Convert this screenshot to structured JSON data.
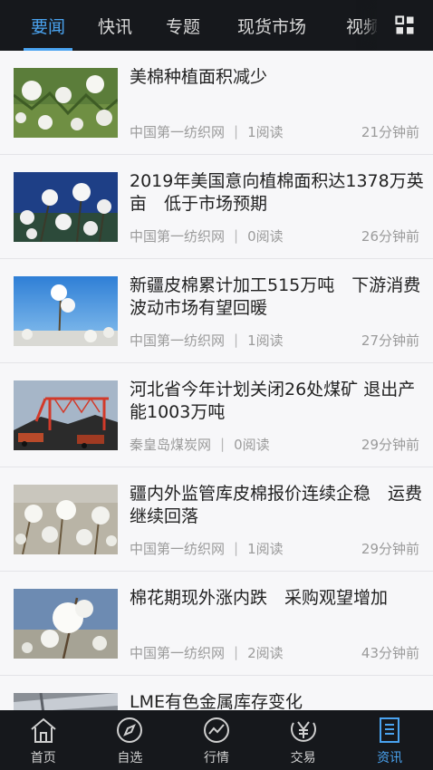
{
  "top_tabs": [
    {
      "label": "要闻",
      "active": true
    },
    {
      "label": "快讯",
      "active": false
    },
    {
      "label": "专题",
      "active": false
    },
    {
      "label": "现货市场",
      "active": false
    },
    {
      "label": "视频",
      "active": false
    }
  ],
  "grid_button_icon": "grid-icon",
  "news": [
    {
      "title": "美棉种植面积减少",
      "source": "中国第一纺织网",
      "reads": "1阅读",
      "time": "21分钟前"
    },
    {
      "title": "2019年美国意向植棉面积达1378万英亩　低于市场预期",
      "source": "中国第一纺织网",
      "reads": "0阅读",
      "time": "26分钟前"
    },
    {
      "title": "新疆皮棉累计加工515万吨　下游消费波动市场有望回暖",
      "source": "中国第一纺织网",
      "reads": "1阅读",
      "time": "27分钟前"
    },
    {
      "title": "河北省今年计划关闭26处煤矿 退出产能1003万吨",
      "source": "秦皇岛煤炭网",
      "reads": "0阅读",
      "time": "29分钟前"
    },
    {
      "title": "疆内外监管库皮棉报价连续企稳　运费继续回落",
      "source": "中国第一纺织网",
      "reads": "1阅读",
      "time": "29分钟前"
    },
    {
      "title": "棉花期现外涨内跌　采购观望增加",
      "source": "中国第一纺织网",
      "reads": "2阅读",
      "time": "43分钟前"
    },
    {
      "title": "LME有色金属库存变化",
      "source": "",
      "reads": "",
      "time": ""
    }
  ],
  "meta_separator": "|",
  "bottom_nav": [
    {
      "label": "首页",
      "icon": "home-icon",
      "active": false
    },
    {
      "label": "自选",
      "icon": "compass-icon",
      "active": false
    },
    {
      "label": "行情",
      "icon": "chart-icon",
      "active": false
    },
    {
      "label": "交易",
      "icon": "yen-icon",
      "active": false
    },
    {
      "label": "资讯",
      "icon": "news-icon",
      "active": true
    }
  ],
  "colors": {
    "accent": "#4aa3f0",
    "bar_bg": "#16181c"
  }
}
